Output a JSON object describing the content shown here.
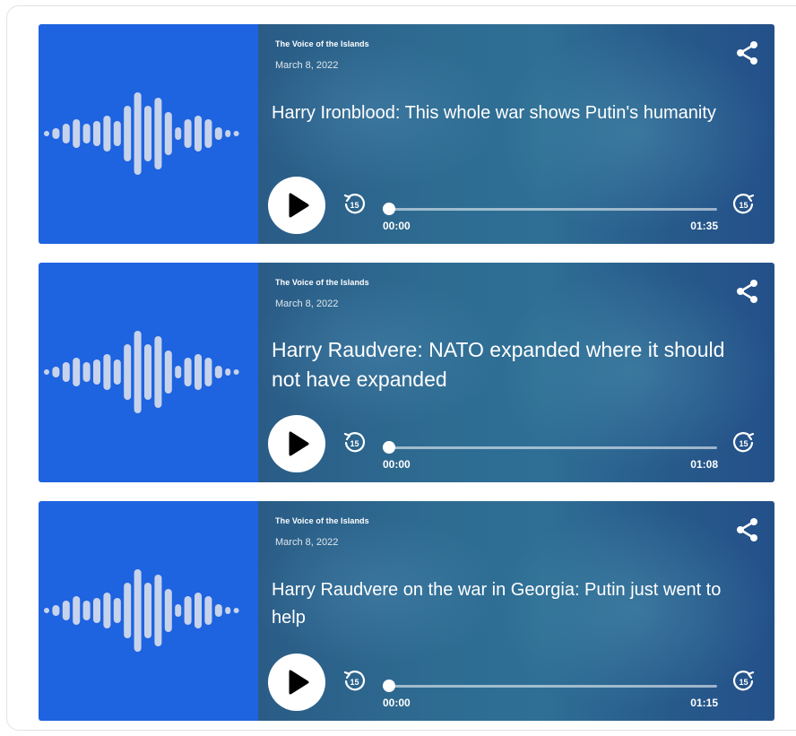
{
  "episodes": [
    {
      "station": "The Voice of the Islands",
      "date": "March 8, 2022",
      "title": "Harry Ironblood: This whole war shows Putin's humanity",
      "time_current": "00:00",
      "duration": "01:35",
      "progress": 0
    },
    {
      "station": "The Voice of the Islands",
      "date": "March 8, 2022",
      "title": "Harry Raudvere: NATO expanded where it should not have expanded",
      "time_current": "00:00",
      "duration": "01:08",
      "progress": 0
    },
    {
      "station": "The Voice of the Islands",
      "date": "March 8, 2022",
      "title": "Harry Raudvere on the war in Georgia: Putin just went to help",
      "time_current": "00:00",
      "duration": "01:15",
      "progress": 0
    }
  ],
  "icons": {
    "waveform": "waveform-icon",
    "share": "share-icon",
    "play": "play-icon",
    "rewind": "rewind-15-icon",
    "forward": "forward-15-icon"
  },
  "skip_seconds": "15",
  "colors": {
    "thumbnail_bg": "#1e63e0",
    "panel_bg": "#2b6390",
    "waveform": "#c7d3ea"
  }
}
